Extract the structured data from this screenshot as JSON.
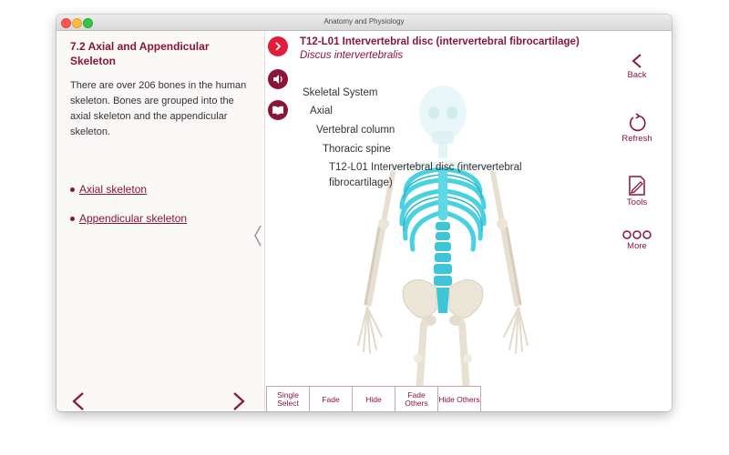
{
  "window": {
    "title": "Anatomy and Physiology"
  },
  "left_panel": {
    "heading": "7.2 Axial and Appendicular Skeleton",
    "body": "There are over 206 bones in the human skeleton. Bones are grouped into the axial skeleton and the appendicular skeleton.",
    "links": [
      "Axial skeleton",
      "Appendicular skeleton"
    ]
  },
  "structure": {
    "title": "T12-L01 Intervertebral disc (intervertebral fibrocartilage)",
    "latin": "Discus intervertebralis",
    "hierarchy": [
      "Skeletal System",
      "Axial",
      "Vertebral column",
      "Thoracic spine",
      "T12-L01 Intervertebral disc (intervertebral",
      "fibrocartilage)"
    ]
  },
  "toolbar": {
    "buttons": [
      "Single Select",
      "Fade",
      "Hide",
      "Fade Others",
      "Hide Others"
    ]
  },
  "right_rail": {
    "back": "Back",
    "refresh": "Refresh",
    "tools": "Tools",
    "more": "More"
  },
  "colors": {
    "accent": "#8a1538",
    "highlight": "#48d1e0",
    "bone": "#e9e3d6"
  }
}
